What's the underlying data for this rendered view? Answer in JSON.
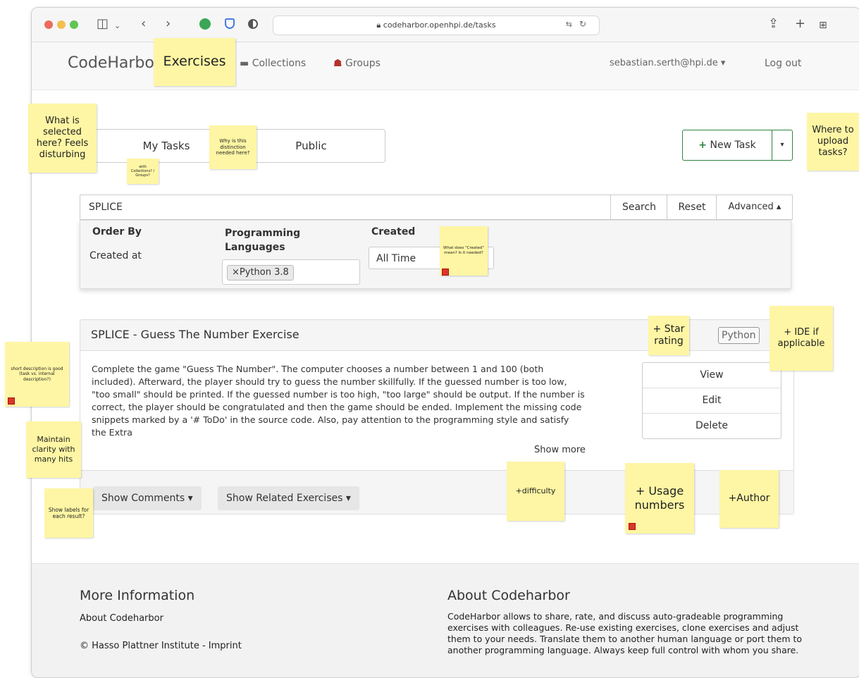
{
  "browser": {
    "url": "codeharbor.openhpi.de/tasks",
    "icons": [
      "sidebar-icon",
      "back-icon",
      "forward-icon",
      "share-icon",
      "new-tab-icon",
      "tab-overview-icon"
    ]
  },
  "navbar": {
    "brand": "CodeHarbor",
    "exercises": "Exercises",
    "collections": "Collections",
    "groups": "Groups",
    "user": "sebastian.serth@hpi.de",
    "logout": "Log out"
  },
  "tabs": {
    "my_tasks": "My Tasks",
    "public": "Public"
  },
  "new_task": {
    "label": "New Task",
    "icon": "plus-icon",
    "color": "#2e8540"
  },
  "search": {
    "value": "SPLICE",
    "search_btn": "Search",
    "reset_btn": "Reset",
    "advanced_btn": "Advanced"
  },
  "advanced": {
    "order_by_label": "Order By",
    "order_by_value": "Created at",
    "lang_label": "Programming Languages",
    "lang_tag": "Python 3.8",
    "created_label": "Created",
    "created_value": "All Time"
  },
  "task": {
    "title": "SPLICE - Guess The Number Exercise",
    "language_badge": "Python",
    "description": "Complete the game \"Guess The Number\". The computer chooses a number between 1 and 100 (both included). Afterward, the player should try to guess the number skillfully. If the guessed number is too low, \"too small\" should be printed. If the guessed number is too high, \"too large\" should be output. If the number is correct, the player should be congratulated and then the game should be ended. Implement the missing code snippets marked by a '# ToDo' in the source code. Also, pay attention to the programming style and satisfy the Extra",
    "show_more": "Show more",
    "actions": {
      "view": "View",
      "edit": "Edit",
      "delete": "Delete"
    },
    "show_comments": "Show Comments",
    "show_related": "Show Related Exercises"
  },
  "footer": {
    "left_heading": "More Information",
    "about_link": "About Codeharbor",
    "copyright": "© Hasso Plattner Institute - Imprint",
    "right_heading": "About Codeharbor",
    "about_text": "CodeHarbor allows to share, rate, and discuss auto-gradeable programming exercises with colleagues. Re-use existing exercises, clone exercises and adjust them to your needs. Translate them to another human language or port them to another programming language. Always keep full control with whom you share."
  },
  "notes": {
    "selected": "What is selected here? Feels disturbing",
    "collections": "with Collections? / Groups?",
    "distinction": "Why is this distinction needed here?",
    "upload": "Where to upload tasks?",
    "created_meaning": "What does \"Created\" mean? Is it needed?",
    "star": "+ Star rating",
    "ide": "+ IDE if applicable",
    "short_desc": "short description is good (task vs. internal description?)",
    "clarity": "Maintain clarity with many hits",
    "labels": "Show labels for each result?",
    "difficulty": "+difficulty",
    "usage": "+ Usage numbers",
    "author": "+Author"
  },
  "colors": {
    "note": "#fef6a4",
    "note_marker": "#d9372b"
  }
}
